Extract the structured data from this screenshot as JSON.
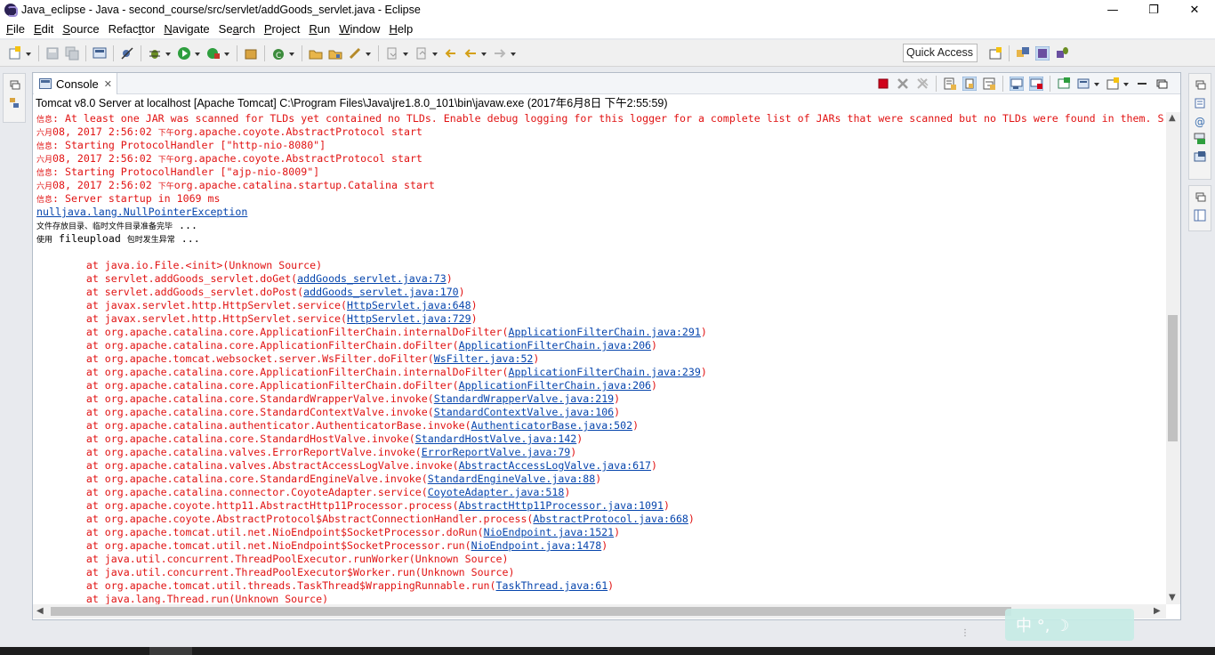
{
  "window": {
    "title": "Java_eclipse - Java - second_course/src/servlet/addGoods_servlet.java - Eclipse",
    "minimize": "—",
    "restore": "❐",
    "close": "✕"
  },
  "menu": [
    {
      "m": "F",
      "r": "ile"
    },
    {
      "m": "E",
      "r": "dit"
    },
    {
      "m": "S",
      "r": "ource"
    },
    {
      "m": "",
      "pre": "Refac",
      "r": "tor",
      "mm": "t"
    },
    {
      "m": "N",
      "r": "avigate"
    },
    {
      "m": "",
      "pre": "Se",
      "mm": "a",
      "r": "rch"
    },
    {
      "m": "P",
      "r": "roject"
    },
    {
      "m": "R",
      "r": "un"
    },
    {
      "m": "W",
      "r": "indow"
    },
    {
      "m": "H",
      "r": "elp"
    }
  ],
  "quick_access": "Quick Access",
  "console": {
    "tab_label": "Console",
    "tab_close": "✕",
    "description": "Tomcat v8.0 Server at localhost [Apache Tomcat] C:\\Program Files\\Java\\jre1.8.0_101\\bin\\javaw.exe (2017年6月8日 下午2:55:59)",
    "lines": [
      {
        "t": "err",
        "parts": [
          {
            "c": "信息",
            "k": "ch"
          },
          {
            "c": ": At least one JAR was scanned for TLDs yet contained no TLDs. Enable debug logging for this logger for a complete list of JARs that were scanned but no TLDs were found in them. S"
          }
        ]
      },
      {
        "t": "err",
        "parts": [
          {
            "c": "六月",
            "k": "ch"
          },
          {
            "c": "08, 2017 2:56:02 "
          },
          {
            "c": "下午",
            "k": "ch"
          },
          {
            "c": "org.apache.coyote.AbstractProtocol start"
          }
        ]
      },
      {
        "t": "err",
        "parts": [
          {
            "c": "信息",
            "k": "ch"
          },
          {
            "c": ": Starting ProtocolHandler [\"http-nio-8080\"]"
          }
        ]
      },
      {
        "t": "err",
        "parts": [
          {
            "c": "六月",
            "k": "ch"
          },
          {
            "c": "08, 2017 2:56:02 "
          },
          {
            "c": "下午",
            "k": "ch"
          },
          {
            "c": "org.apache.coyote.AbstractProtocol start"
          }
        ]
      },
      {
        "t": "err",
        "parts": [
          {
            "c": "信息",
            "k": "ch"
          },
          {
            "c": ": Starting ProtocolHandler [\"ajp-nio-8009\"]"
          }
        ]
      },
      {
        "t": "err",
        "parts": [
          {
            "c": "六月",
            "k": "ch"
          },
          {
            "c": "08, 2017 2:56:02 "
          },
          {
            "c": "下午",
            "k": "ch"
          },
          {
            "c": "org.apache.catalina.startup.Catalina start"
          }
        ]
      },
      {
        "t": "err",
        "parts": [
          {
            "c": "信息",
            "k": "ch"
          },
          {
            "c": ": Server startup in 1069 ms"
          }
        ]
      },
      {
        "t": "out",
        "parts": [
          {
            "c": "nulljava.lang.NullPointerException",
            "k": "lnk"
          }
        ]
      },
      {
        "t": "out",
        "parts": [
          {
            "c": "文件存放目录、临时文件目录准备完毕",
            "k": "ch"
          },
          {
            "c": " ..."
          }
        ]
      },
      {
        "t": "out",
        "parts": [
          {
            "c": "使用",
            "k": "ch"
          },
          {
            "c": " fileupload "
          },
          {
            "c": "包时发生异常",
            "k": "ch"
          },
          {
            "c": " ..."
          }
        ]
      },
      {
        "t": "out",
        "parts": [
          {
            "c": ""
          }
        ]
      },
      {
        "t": "err",
        "parts": [
          {
            "c": "\tat java.io.File.<init>(Unknown Source)"
          }
        ]
      },
      {
        "t": "err",
        "parts": [
          {
            "c": "\tat servlet.addGoods_servlet.doGet("
          },
          {
            "c": "addGoods_servlet.java:73",
            "k": "lnk"
          },
          {
            "c": ")"
          }
        ]
      },
      {
        "t": "err",
        "parts": [
          {
            "c": "\tat servlet.addGoods_servlet.doPost("
          },
          {
            "c": "addGoods_servlet.java:170",
            "k": "lnk"
          },
          {
            "c": ")"
          }
        ]
      },
      {
        "t": "err",
        "parts": [
          {
            "c": "\tat javax.servlet.http.HttpServlet.service("
          },
          {
            "c": "HttpServlet.java:648",
            "k": "lnk"
          },
          {
            "c": ")"
          }
        ]
      },
      {
        "t": "err",
        "parts": [
          {
            "c": "\tat javax.servlet.http.HttpServlet.service("
          },
          {
            "c": "HttpServlet.java:729",
            "k": "lnk"
          },
          {
            "c": ")"
          }
        ]
      },
      {
        "t": "err",
        "parts": [
          {
            "c": "\tat org.apache.catalina.core.ApplicationFilterChain.internalDoFilter("
          },
          {
            "c": "ApplicationFilterChain.java:291",
            "k": "lnk"
          },
          {
            "c": ")"
          }
        ]
      },
      {
        "t": "err",
        "parts": [
          {
            "c": "\tat org.apache.catalina.core.ApplicationFilterChain.doFilter("
          },
          {
            "c": "ApplicationFilterChain.java:206",
            "k": "lnk"
          },
          {
            "c": ")"
          }
        ]
      },
      {
        "t": "err",
        "parts": [
          {
            "c": "\tat org.apache.tomcat.websocket.server.WsFilter.doFilter("
          },
          {
            "c": "WsFilter.java:52",
            "k": "lnk"
          },
          {
            "c": ")"
          }
        ]
      },
      {
        "t": "err",
        "parts": [
          {
            "c": "\tat org.apache.catalina.core.ApplicationFilterChain.internalDoFilter("
          },
          {
            "c": "ApplicationFilterChain.java:239",
            "k": "lnk"
          },
          {
            "c": ")"
          }
        ]
      },
      {
        "t": "err",
        "parts": [
          {
            "c": "\tat org.apache.catalina.core.ApplicationFilterChain.doFilter("
          },
          {
            "c": "ApplicationFilterChain.java:206",
            "k": "lnk"
          },
          {
            "c": ")"
          }
        ]
      },
      {
        "t": "err",
        "parts": [
          {
            "c": "\tat org.apache.catalina.core.StandardWrapperValve.invoke("
          },
          {
            "c": "StandardWrapperValve.java:219",
            "k": "lnk"
          },
          {
            "c": ")"
          }
        ]
      },
      {
        "t": "err",
        "parts": [
          {
            "c": "\tat org.apache.catalina.core.StandardContextValve.invoke("
          },
          {
            "c": "StandardContextValve.java:106",
            "k": "lnk"
          },
          {
            "c": ")"
          }
        ]
      },
      {
        "t": "err",
        "parts": [
          {
            "c": "\tat org.apache.catalina.authenticator.AuthenticatorBase.invoke("
          },
          {
            "c": "AuthenticatorBase.java:502",
            "k": "lnk"
          },
          {
            "c": ")"
          }
        ]
      },
      {
        "t": "err",
        "parts": [
          {
            "c": "\tat org.apache.catalina.core.StandardHostValve.invoke("
          },
          {
            "c": "StandardHostValve.java:142",
            "k": "lnk"
          },
          {
            "c": ")"
          }
        ]
      },
      {
        "t": "err",
        "parts": [
          {
            "c": "\tat org.apache.catalina.valves.ErrorReportValve.invoke("
          },
          {
            "c": "ErrorReportValve.java:79",
            "k": "lnk"
          },
          {
            "c": ")"
          }
        ]
      },
      {
        "t": "err",
        "parts": [
          {
            "c": "\tat org.apache.catalina.valves.AbstractAccessLogValve.invoke("
          },
          {
            "c": "AbstractAccessLogValve.java:617",
            "k": "lnk"
          },
          {
            "c": ")"
          }
        ]
      },
      {
        "t": "err",
        "parts": [
          {
            "c": "\tat org.apache.catalina.core.StandardEngineValve.invoke("
          },
          {
            "c": "StandardEngineValve.java:88",
            "k": "lnk"
          },
          {
            "c": ")"
          }
        ]
      },
      {
        "t": "err",
        "parts": [
          {
            "c": "\tat org.apache.catalina.connector.CoyoteAdapter.service("
          },
          {
            "c": "CoyoteAdapter.java:518",
            "k": "lnk"
          },
          {
            "c": ")"
          }
        ]
      },
      {
        "t": "err",
        "parts": [
          {
            "c": "\tat org.apache.coyote.http11.AbstractHttp11Processor.process("
          },
          {
            "c": "AbstractHttp11Processor.java:1091",
            "k": "lnk"
          },
          {
            "c": ")"
          }
        ]
      },
      {
        "t": "err",
        "parts": [
          {
            "c": "\tat org.apache.coyote.AbstractProtocol$AbstractConnectionHandler.process("
          },
          {
            "c": "AbstractProtocol.java:668",
            "k": "lnk"
          },
          {
            "c": ")"
          }
        ]
      },
      {
        "t": "err",
        "parts": [
          {
            "c": "\tat org.apache.tomcat.util.net.NioEndpoint$SocketProcessor.doRun("
          },
          {
            "c": "NioEndpoint.java:1521",
            "k": "lnk"
          },
          {
            "c": ")"
          }
        ]
      },
      {
        "t": "err",
        "parts": [
          {
            "c": "\tat org.apache.tomcat.util.net.NioEndpoint$SocketProcessor.run("
          },
          {
            "c": "NioEndpoint.java:1478",
            "k": "lnk"
          },
          {
            "c": ")"
          }
        ]
      },
      {
        "t": "err",
        "parts": [
          {
            "c": "\tat java.util.concurrent.ThreadPoolExecutor.runWorker(Unknown Source)"
          }
        ]
      },
      {
        "t": "err",
        "parts": [
          {
            "c": "\tat java.util.concurrent.ThreadPoolExecutor$Worker.run(Unknown Source)"
          }
        ]
      },
      {
        "t": "err",
        "parts": [
          {
            "c": "\tat org.apache.tomcat.util.threads.TaskThread$WrappingRunnable.run("
          },
          {
            "c": "TaskThread.java:61",
            "k": "lnk"
          },
          {
            "c": ")"
          }
        ]
      },
      {
        "t": "err",
        "parts": [
          {
            "c": "\tat java.lang.Thread.run(Unknown Source)"
          }
        ]
      }
    ]
  },
  "ime": {
    "text": "中 °, ☽"
  },
  "colors": {
    "error_text": "#e11313",
    "link": "#0645ad",
    "terminate": "#d0021b"
  }
}
